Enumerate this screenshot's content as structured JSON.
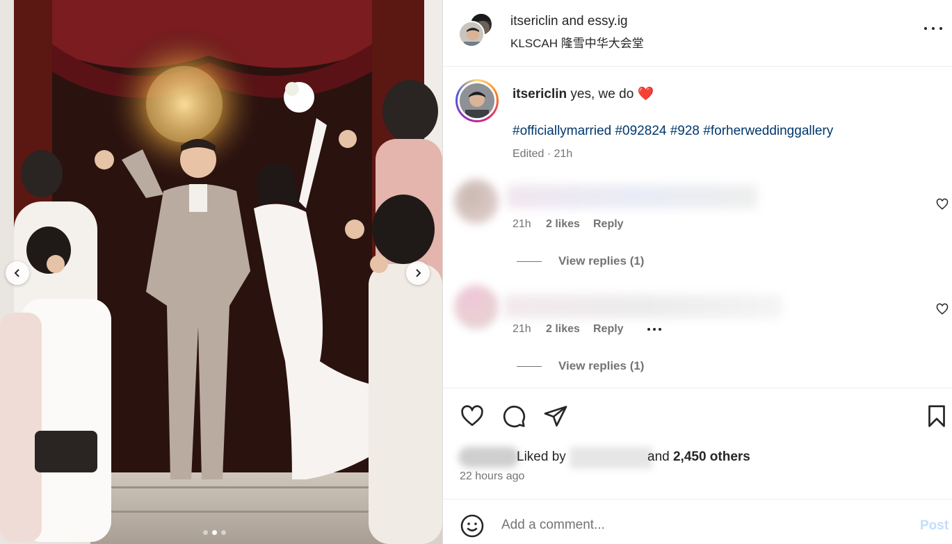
{
  "photo": {
    "prev_icon": "chevron-left-icon",
    "next_icon": "chevron-right-icon",
    "slide_count": 3,
    "active_slide": 2
  },
  "header": {
    "user1": "itsericlin",
    "and_word": " and ",
    "user2": "essy.ig",
    "location": "KLSCAH 隆雪中华大会堂",
    "more_icon": "more-horizontal-icon"
  },
  "caption": {
    "username": "itsericlin",
    "text": " yes, we do ",
    "emoji": "❤️",
    "hashtags": "#officiallymarried #092824 #928 #forherweddinggallery",
    "meta": "Edited · 21h"
  },
  "comments": [
    {
      "time": "21h",
      "likes": "2 likes",
      "reply": "Reply",
      "view_replies": "View replies (1)"
    },
    {
      "time": "21h",
      "likes": "2 likes",
      "reply": "Reply",
      "view_replies": "View replies (1)"
    }
  ],
  "actions": {
    "liked_by": "Liked by",
    "and_text": "and ",
    "others": "2,450 others",
    "time_ago": "22 hours ago"
  },
  "comment_box": {
    "placeholder": "Add a comment...",
    "post_label": "Post"
  },
  "colors": {
    "link_blue": "#00376b",
    "secondary_text": "#737373",
    "post_disabled": "#c0dffd"
  }
}
